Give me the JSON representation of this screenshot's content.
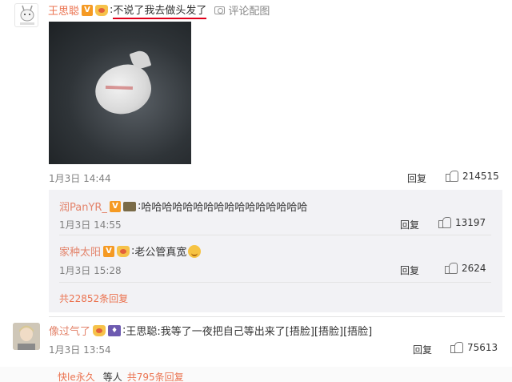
{
  "post": {
    "author": "王思聪",
    "text": "不说了我去做头发了",
    "image_link": "评论配图",
    "time": "1月3日 14:44",
    "reply_label": "回复",
    "likes": "214515"
  },
  "sub_replies": [
    {
      "user": "润PanYR_",
      "text": "哈哈哈哈哈哈哈哈哈哈哈哈哈哈哈哈",
      "time": "1月3日 14:55",
      "reply_label": "回复",
      "likes": "13197"
    },
    {
      "user": "家种太阳",
      "text": "老公管真宽",
      "time": "1月3日 15:28",
      "reply_label": "回复",
      "likes": "2624"
    }
  ],
  "more_replies": "共22852条回复",
  "second_comment": {
    "user": "像过气了",
    "text": "王思聪:我等了一夜把自己等出来了[捂脸][捂脸][捂脸]",
    "time": "1月3日 13:54",
    "reply_label": "回复",
    "likes": "75613"
  },
  "footer_line": {
    "user": "快le永久",
    "middle": "等人",
    "count": "共795条回复"
  },
  "colors": {
    "accent": "#eb7350",
    "underline": "#e0001b",
    "subbox": "#f2f2f5"
  },
  "icons": [
    "v-badge-icon",
    "crown-icon",
    "camera-icon",
    "thumb-up-icon",
    "laugh-emoji-icon"
  ]
}
